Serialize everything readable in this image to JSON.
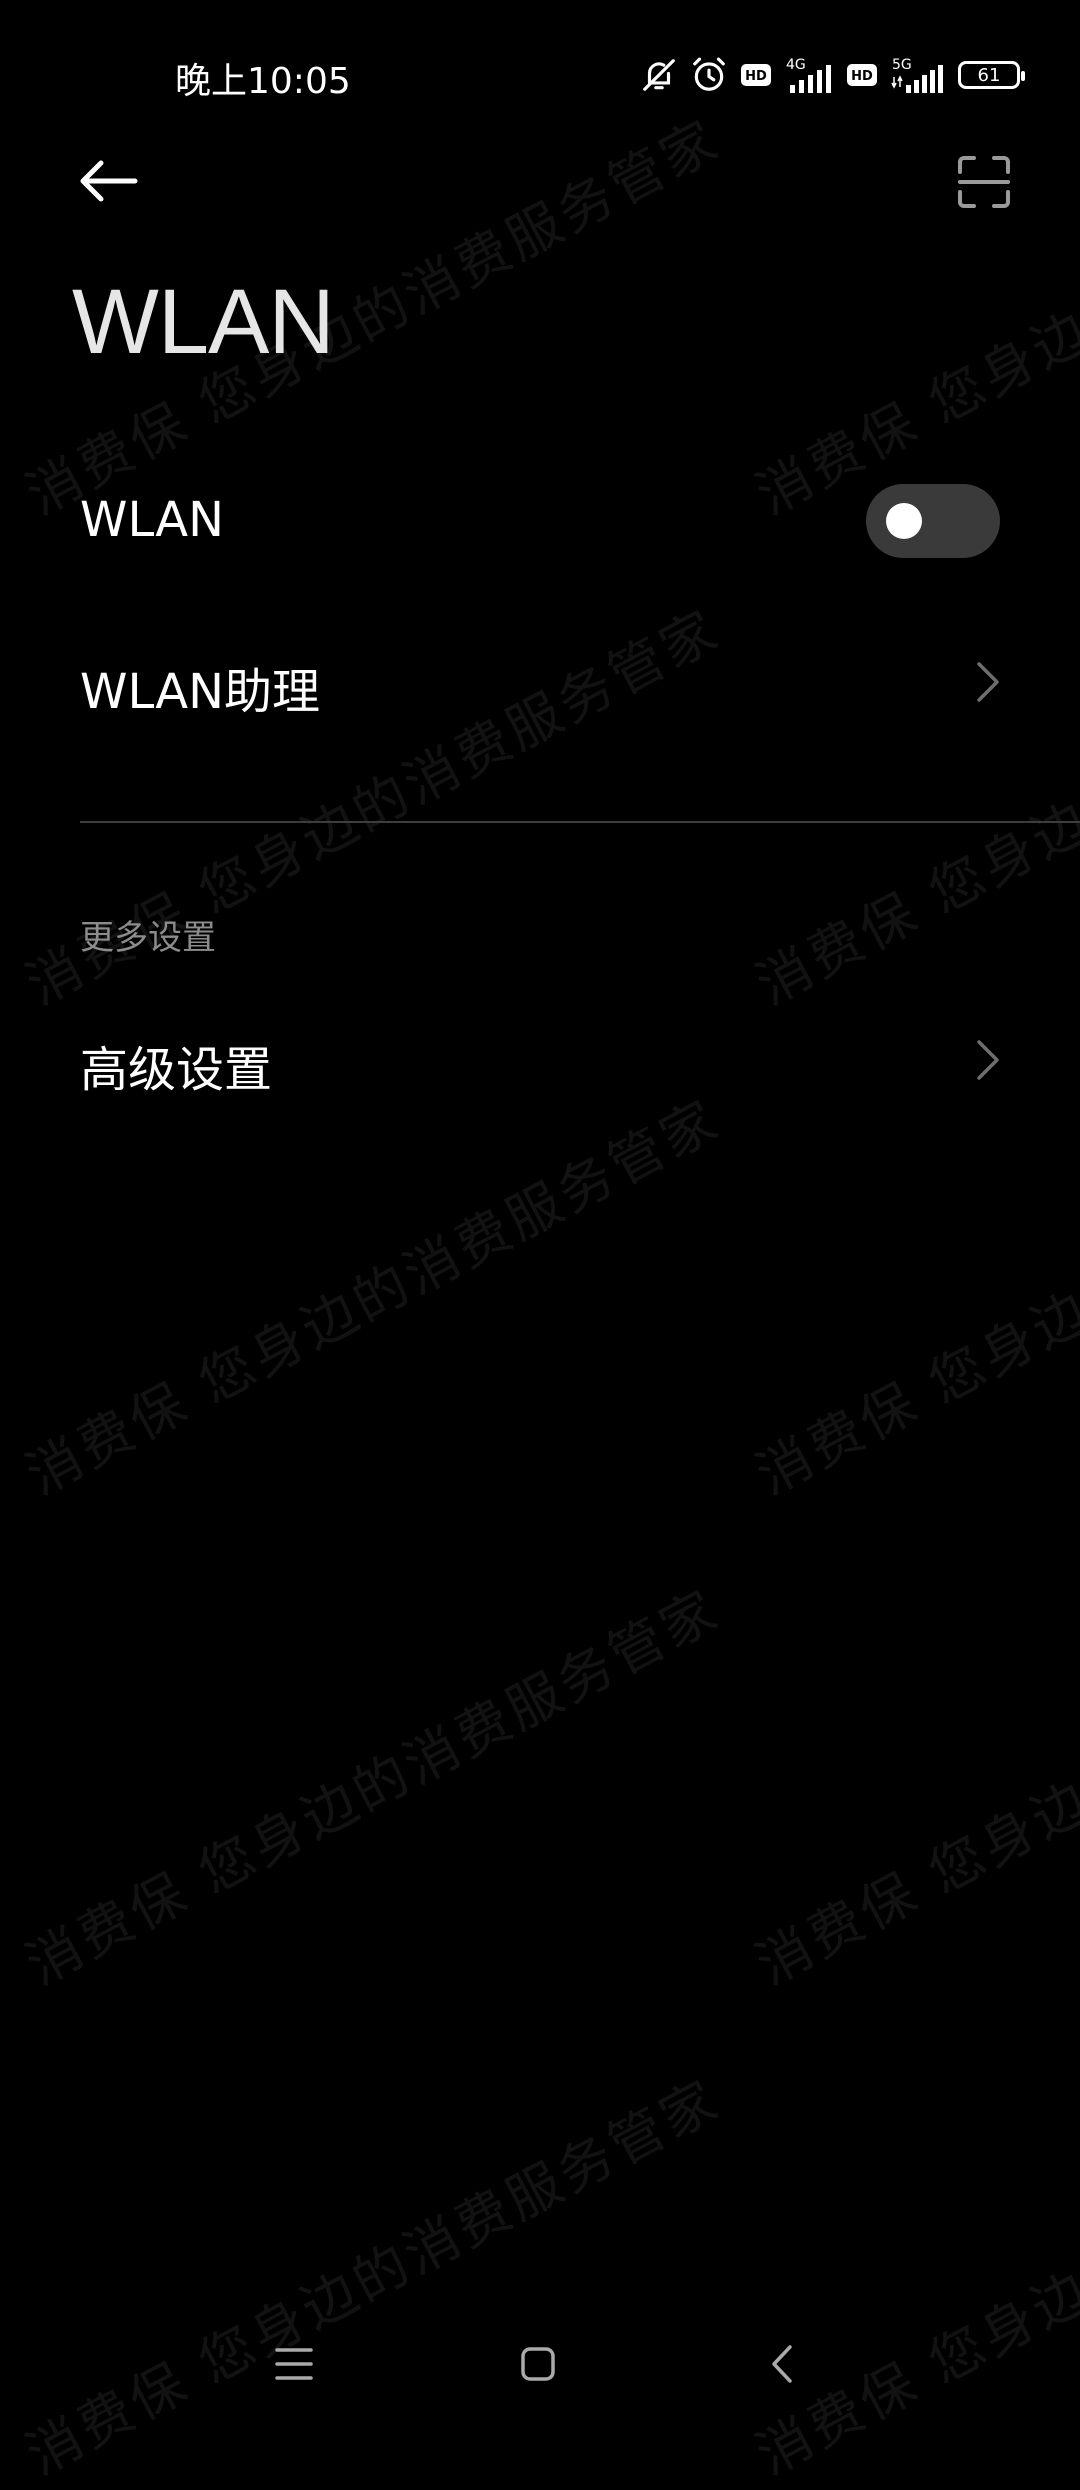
{
  "status_bar": {
    "time": "晚上10:05",
    "sim1_network": "4G",
    "sim2_network": "5G",
    "hd_label": "HD",
    "battery": "61",
    "icons": [
      "bell-off-icon",
      "alarm-icon",
      "hd-icon",
      "signal-icon",
      "hd-icon",
      "signal-icon",
      "battery-icon"
    ]
  },
  "header": {
    "title": "WLAN",
    "back_icon": "arrow-left-icon",
    "scan_icon": "scan-icon"
  },
  "settings": {
    "wlan": {
      "label": "WLAN",
      "enabled": false
    },
    "assistant": {
      "label": "WLAN助理"
    },
    "section_more": "更多设置",
    "advanced": {
      "label": "高级设置"
    }
  },
  "watermark": {
    "line1": "消费保  您身边的消费服务管家",
    "line2": "消费保  您身边的消费服务管家"
  },
  "nav_bar": {
    "icons": [
      "menu-icon",
      "home-icon",
      "back-icon"
    ]
  }
}
